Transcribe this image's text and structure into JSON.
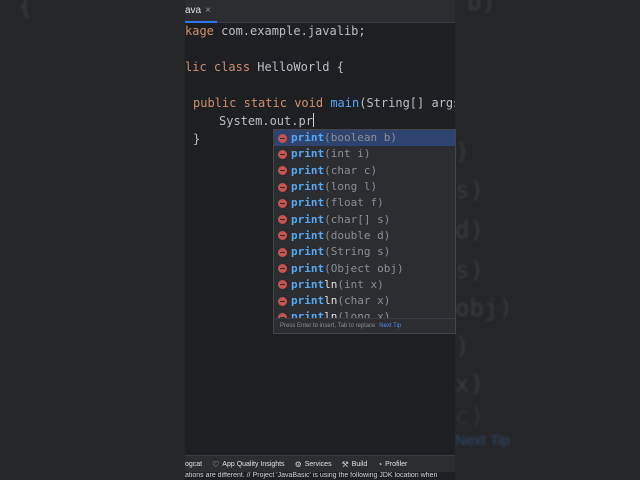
{
  "editor_tab": {
    "label": "ava",
    "close": "×"
  },
  "code": {
    "line1": {
      "prefix": "kage",
      "rest": " com.example.javalib;"
    },
    "line2": {
      "kw1": "lic",
      "kw2": "class",
      "name": "HelloWorld",
      "brace": "{"
    },
    "line3": {
      "kw1": "public",
      "kw2": "static",
      "kw3": "void",
      "method": "main",
      "params": "(String[] args){"
    },
    "line4": {
      "typed": "System.out.pr"
    },
    "line5": {
      "brace": "}"
    }
  },
  "completion": {
    "items": [
      {
        "match": "print",
        "rest": "",
        "params": "(boolean b)"
      },
      {
        "match": "print",
        "rest": "",
        "params": "(int i)"
      },
      {
        "match": "print",
        "rest": "",
        "params": "(char c)"
      },
      {
        "match": "print",
        "rest": "",
        "params": "(long l)"
      },
      {
        "match": "print",
        "rest": "",
        "params": "(float f)"
      },
      {
        "match": "print",
        "rest": "",
        "params": "(char[] s)"
      },
      {
        "match": "print",
        "rest": "",
        "params": "(double d)"
      },
      {
        "match": "print",
        "rest": "",
        "params": "(String s)"
      },
      {
        "match": "print",
        "rest": "",
        "params": "(Object obj)"
      },
      {
        "match": "print",
        "rest": "ln",
        "params": "(int x)"
      },
      {
        "match": "print",
        "rest": "ln",
        "params": "(char x)"
      },
      {
        "match": "print",
        "rest": "ln",
        "params": "(long x)"
      }
    ],
    "footer_text": "Press Enter to insert, Tab to replace",
    "footer_link": "Next Tip"
  },
  "toolbar": {
    "items": [
      {
        "icon": "logcat-icon",
        "glyph": "",
        "label": "ogcat"
      },
      {
        "icon": "app-quality-insights-icon",
        "glyph": "♡",
        "label": "App Quality Insights"
      },
      {
        "icon": "services-icon",
        "glyph": "⚙",
        "label": "Services"
      },
      {
        "icon": "build-icon",
        "glyph": "⚒",
        "label": "Build"
      },
      {
        "icon": "profiler-icon",
        "glyph": "◔",
        "label": "Profiler"
      }
    ]
  },
  "status": {
    "text": "ations are different. // Project 'JavaBasic' is using the following JDK location when"
  },
  "background": {
    "left_glyph": "{",
    "right_lines": [
      "b)",
      ")",
      "s)",
      "d)",
      "s)",
      "obj)",
      ")",
      "x)",
      "c)"
    ],
    "right_link": "Next Tip"
  },
  "colors": {
    "keyword": "#cf8e6d",
    "method": "#56a8f5",
    "selection": "#2e436e",
    "method_icon": "#c75450"
  }
}
